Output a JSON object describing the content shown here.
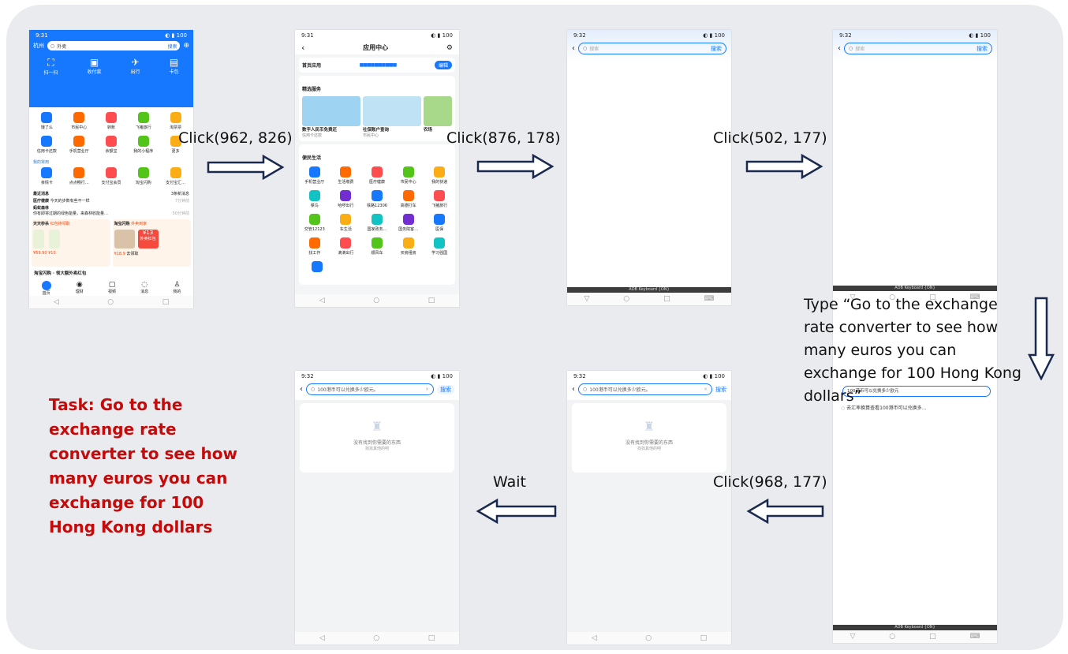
{
  "task_text": "Task: Go to the exchange rate converter to see how many euros you can exchange for 100 Hong Kong dollars",
  "steps": [
    {
      "label": "Click(962, 826)"
    },
    {
      "label": "Click(876, 178)"
    },
    {
      "label": "Click(502, 177)"
    },
    {
      "label": "Type “Go to the exchange rate converter to see how many euros you can exchange for 100 Hong Kong dollars”"
    },
    {
      "label": "Click(968, 177)"
    },
    {
      "label": "Wait"
    }
  ],
  "screen1": {
    "time": "9:31",
    "city": "杭州",
    "search_text": "外卖",
    "search_btn": "搜索",
    "top_actions": [
      "扫一扫",
      "收付款",
      "出行",
      "卡包"
    ],
    "apps_row1": [
      "饿了么",
      "市民中心",
      "转账",
      "飞猪旅行",
      "淘票票"
    ],
    "apps_row2": [
      "信用卡还款",
      "手机营业厅",
      "余额宝",
      "我的小程序",
      "更多"
    ],
    "my_apps_title": "我的常用",
    "apps_row3": [
      "亲情卡",
      "点点畅行…",
      "支付宝会员",
      "淘宝闪购",
      "支付宝汇…"
    ],
    "recent_title": "最近消息",
    "recent_count": "3条新消息",
    "msg1_title": "医疗健康",
    "msg1_text": "今天的步数有些不一样",
    "msg1_time": "7分钟前",
    "msg2_title": "蚂蚁森林",
    "msg2_text": "你有即将过期的绿色能量，来森林收能量…",
    "msg2_time": "50分钟前",
    "card1_title": "天天秒杀",
    "card1_tag": "红包待领取",
    "card2_title": "淘宝闪购",
    "card2_tag": "外卖到家",
    "price1": "¥69.90",
    "price2": "¥10",
    "price3": "¥18.9",
    "coupon": "¥13",
    "coupon_label": "外卖红包",
    "coupon_btn": "去领取",
    "promo": "淘宝闪购 · 领大额外卖红包",
    "tabs": [
      "首页",
      "理财",
      "视频",
      "消息",
      "我的"
    ]
  },
  "screen2": {
    "time": "9:31",
    "title": "应用中心",
    "home_apps_label": "首页应用",
    "edit_btn": "编辑",
    "featured_title": "精选服务",
    "featured": [
      {
        "title": "数字人民币免费还",
        "sub": "信用卡还款"
      },
      {
        "title": "社保账户查询",
        "sub": "市民中心"
      },
      {
        "title": "农场",
        "sub": ""
      }
    ],
    "civic_title": "便民生活",
    "civic_apps": [
      "手机营业厅",
      "生活缴费",
      "医疗健康",
      "市民中心",
      "我的快递",
      "菜鸟",
      "哈啰出行",
      "铁路12306",
      "高德打车",
      "飞猪旅行",
      "交管12123",
      "车生活",
      "国家政务…",
      "国务院客…",
      "医保",
      "找工作",
      "滴滴出行",
      "顺风车",
      "买房租房",
      "学习强国"
    ]
  },
  "screen3": {
    "time": "9:32",
    "placeholder": "搜索",
    "search_btn": "搜索",
    "keyboard": "ADB Keyboard {ON}"
  },
  "screen4": {
    "time": "9:32",
    "placeholder": "搜索",
    "search_btn": "搜索",
    "input_text": "100港币可以兑换多少欧元",
    "suggestion": "去汇率换算查看100港币可以兑换多…",
    "keyboard": "ADB Keyboard {ON}"
  },
  "screen5": {
    "time": "9:32",
    "query": "100港币可以兑换多少欧元。",
    "search_btn": "搜索",
    "empty_title": "没有找到你需要的东西",
    "empty_sub": "找找其他的吧"
  },
  "screen6": {
    "time": "9:32",
    "query": "100港币可以兑换多少欧元。",
    "search_btn": "搜索",
    "empty_title": "没有找到你需要的东西",
    "empty_sub": "找找其他的吧"
  },
  "colors": {
    "alipay_blue": "#1677ff",
    "task_red": "#c40a0a",
    "arrow_navy": "#1a2a4f"
  }
}
